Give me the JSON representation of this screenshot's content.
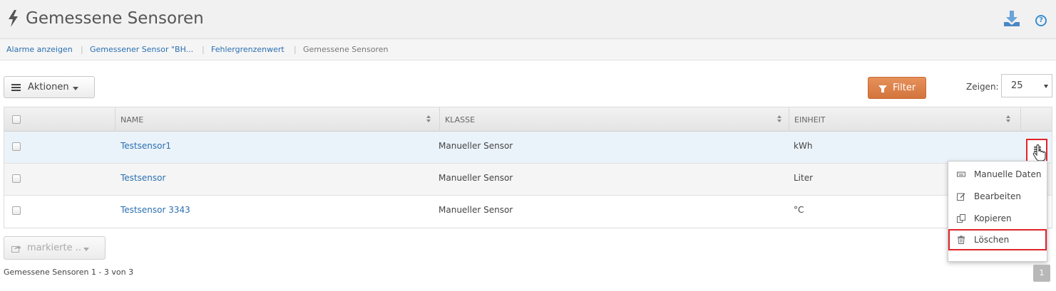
{
  "header": {
    "title": "Gemessene Sensoren",
    "icon": "bolt-icon",
    "help_symbol": "?"
  },
  "breadcrumb": {
    "items": [
      {
        "label": "Alarme anzeigen",
        "link": true
      },
      {
        "label": "Gemessener Sensor \"BH...",
        "link": true
      },
      {
        "label": "Fehlergrenzenwert",
        "link": true
      },
      {
        "label": "Gemessene Sensoren",
        "link": false
      }
    ],
    "separator": "|"
  },
  "toolbar": {
    "aktionen_label": "Aktionen",
    "filter_label": "Filter",
    "zeigen_label": "Zeigen:",
    "zeigen_value": "25"
  },
  "table": {
    "columns": [
      "NAME",
      "KLASSE",
      "EINHEIT"
    ],
    "rows": [
      {
        "name": "Testsensor1",
        "klasse": "Manueller Sensor",
        "einheit": "kWh"
      },
      {
        "name": "Testsensor",
        "klasse": "Manueller Sensor",
        "einheit": "Liter"
      },
      {
        "name": "Testsensor 3343",
        "klasse": "Manueller Sensor",
        "einheit": "°C"
      }
    ]
  },
  "row_menu": {
    "items": [
      {
        "label": "Manuelle Daten",
        "icon": "keyboard-icon"
      },
      {
        "label": "Bearbeiten",
        "icon": "edit-icon"
      },
      {
        "label": "Kopieren",
        "icon": "copy-icon"
      },
      {
        "label": "Löschen",
        "icon": "trash-icon"
      }
    ]
  },
  "footer": {
    "markierte_label": "markierte ..",
    "summary": "Gemessene Sensoren 1 - 3 von 3",
    "page": "1"
  },
  "colors": {
    "accent_link": "#2a6fb0",
    "filter_button": "#d97e46",
    "highlight_red": "#e0252a",
    "selected_row": "#ebf3fa"
  }
}
